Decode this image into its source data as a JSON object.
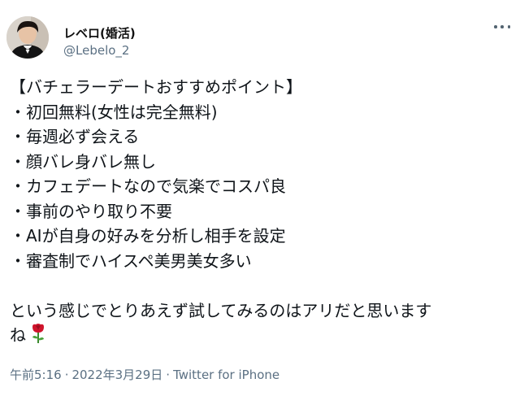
{
  "user": {
    "display_name": "レベロ(婚活)",
    "handle": "@Lebelo_2"
  },
  "tweet": {
    "lines": [
      "【バチェラーデートおすすめポイント】",
      "・初回無料(女性は完全無料)",
      "・毎週必ず会える",
      "・顔バレ身バレ無し",
      "・カフェデートなので気楽でコスパ良",
      "・事前のやり取り不要",
      "・AIが自身の好みを分析し相手を設定",
      "・審査制でハイスペ美男美女多い"
    ],
    "closing_line1": "という感じでとりあえず試してみるのはアリだと思います",
    "closing_line2": "ね",
    "emoji_icon": "rose-icon"
  },
  "meta": {
    "time": "午前5:16",
    "date": "2022年3月29日",
    "source": "Twitter for iPhone",
    "separator": "·"
  },
  "colors": {
    "text": "#0f1419",
    "secondary": "#5b7083",
    "rose": "#d0142c"
  }
}
